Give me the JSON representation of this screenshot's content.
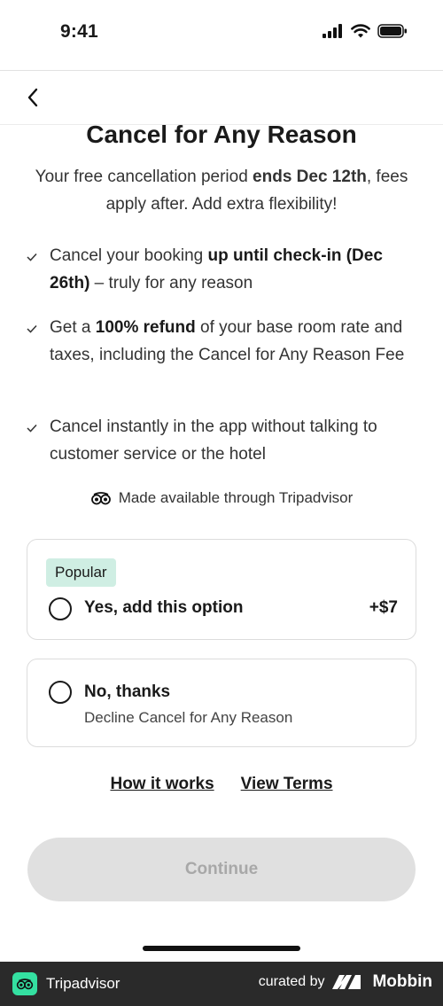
{
  "status_bar": {
    "time": "9:41",
    "signal_icon": "cellular-signal-icon",
    "wifi_icon": "wifi-icon",
    "battery_icon": "battery-icon"
  },
  "nav": {
    "back_icon": "chevron-left-icon"
  },
  "header": {
    "title": "Cancel for Any Reason",
    "subtitle_pre": "Your free cancellation period ",
    "subtitle_bold": "ends Dec 12th",
    "subtitle_post": ", fees apply after. Add extra flexibility!"
  },
  "benefits": [
    {
      "pre": "Cancel your booking ",
      "bold": "up until check-in (Dec 26th)",
      "post": " – truly for any reason"
    },
    {
      "pre": "Get a ",
      "bold": "100% refund",
      "post": " of your base room rate and taxes, including the Cancel for Any Reason Fee"
    },
    {
      "pre": "Cancel instantly in the app without talking to customer service or the hotel",
      "bold": "",
      "post": ""
    }
  ],
  "attribution": {
    "text": "Made available through Tripadvisor",
    "icon": "tripadvisor-owl-icon"
  },
  "options": {
    "yes": {
      "badge": "Popular",
      "label": "Yes, add this option",
      "price": "+$7"
    },
    "no": {
      "label": "No, thanks",
      "sublabel": "Decline Cancel for Any Reason"
    }
  },
  "links": {
    "how_it_works": "How it works",
    "view_terms": "View Terms"
  },
  "continue_label": "Continue",
  "footer": {
    "brand": "Tripadvisor",
    "curated_by": "curated by",
    "mobbin": "Mobbin"
  },
  "colors": {
    "accent_badge": "#cfeee3",
    "disabled_button": "#e0e0e0",
    "footer_bg": "#2a2a2a",
    "tripadvisor_green": "#34e0a1"
  }
}
